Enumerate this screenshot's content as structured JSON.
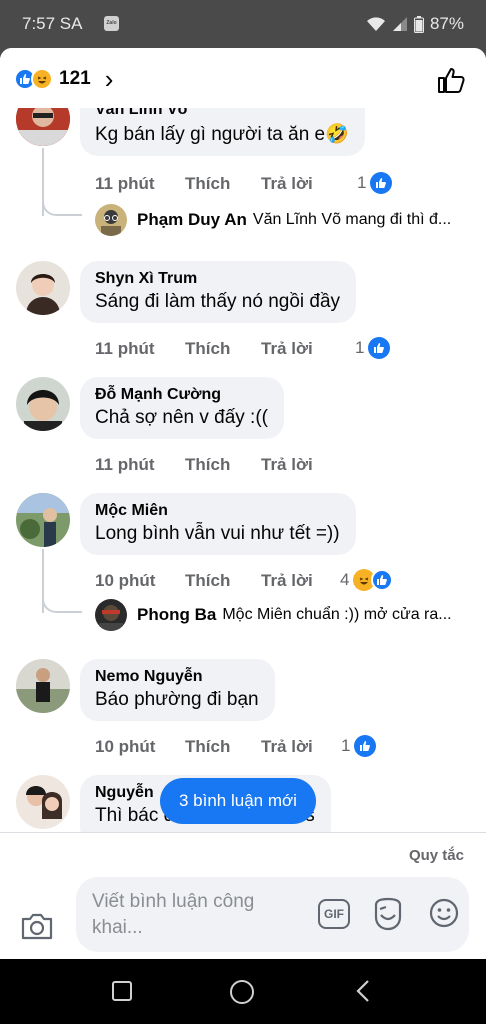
{
  "status_bar": {
    "time": "7:57 SA",
    "app_badge": "Zalo",
    "battery": "87%"
  },
  "header": {
    "reaction_count": "121",
    "icons": [
      "like-icon",
      "haha-icon",
      "chevron-right-icon",
      "thumbs-up-icon"
    ]
  },
  "comments": [
    {
      "name": "Văn Lĩnh Võ",
      "text": "Kg bán lấy gì người ta ăn e🤣",
      "time": "11 phút",
      "like_label": "Thích",
      "reply_label": "Trả lời",
      "reactions": "1",
      "reply": {
        "name": "Phạm Duy An",
        "text": "Văn Lĩnh Võ mang đi thì đ..."
      }
    },
    {
      "name": "Shyn Xì Trum",
      "text": "Sáng đi làm thấy nó ngồi đầy",
      "time": "11 phút",
      "like_label": "Thích",
      "reply_label": "Trả lời",
      "reactions": "1"
    },
    {
      "name": "Đỗ Mạnh Cường",
      "text": "Chả sợ nên v đấy :((",
      "time": "11 phút",
      "like_label": "Thích",
      "reply_label": "Trả lời"
    },
    {
      "name": "Mộc Miên",
      "text": "Long bình vẫn vui như tết =))",
      "time": "10 phút",
      "like_label": "Thích",
      "reply_label": "Trả lời",
      "reactions": "4",
      "reply": {
        "name": "Phong Ba",
        "text": "Mộc Miên chuẩn :)) mở cửa ra..."
      }
    },
    {
      "name": "Nemo Nguyễn",
      "text": "Báo phường đi bạn",
      "time": "10 phút",
      "like_label": "Thích",
      "reply_label": "Trả lời",
      "reactions": "1"
    },
    {
      "name": "Nguyễn",
      "text": "Thì bác điện báo cả chứ s"
    }
  ],
  "new_comments_pill": "3 bình luận mới",
  "footer": {
    "rules_link": "Quy tắc",
    "input_placeholder": "Viết bình luận công khai...",
    "gif_label": "GIF"
  },
  "colors": {
    "accent": "#1877f2",
    "bubble": "#f0f2f5",
    "secondary_text": "#65676b",
    "haha": "#f7b125"
  }
}
